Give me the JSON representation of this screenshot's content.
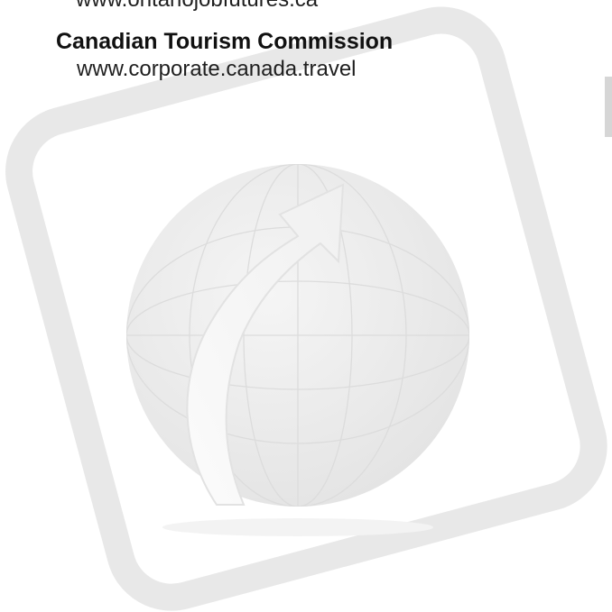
{
  "entries": [
    {
      "org": "",
      "url": "www.ontariojobfutures.ca"
    },
    {
      "org": "Canadian Tourism Commission",
      "url": "www.corporate.canada.travel"
    }
  ],
  "watermark": {
    "icon": "globe-arrow-icon",
    "frame_color": "#e7e7e7",
    "globe_color": "#ededed",
    "arrow_color": "#f7f7f7"
  }
}
